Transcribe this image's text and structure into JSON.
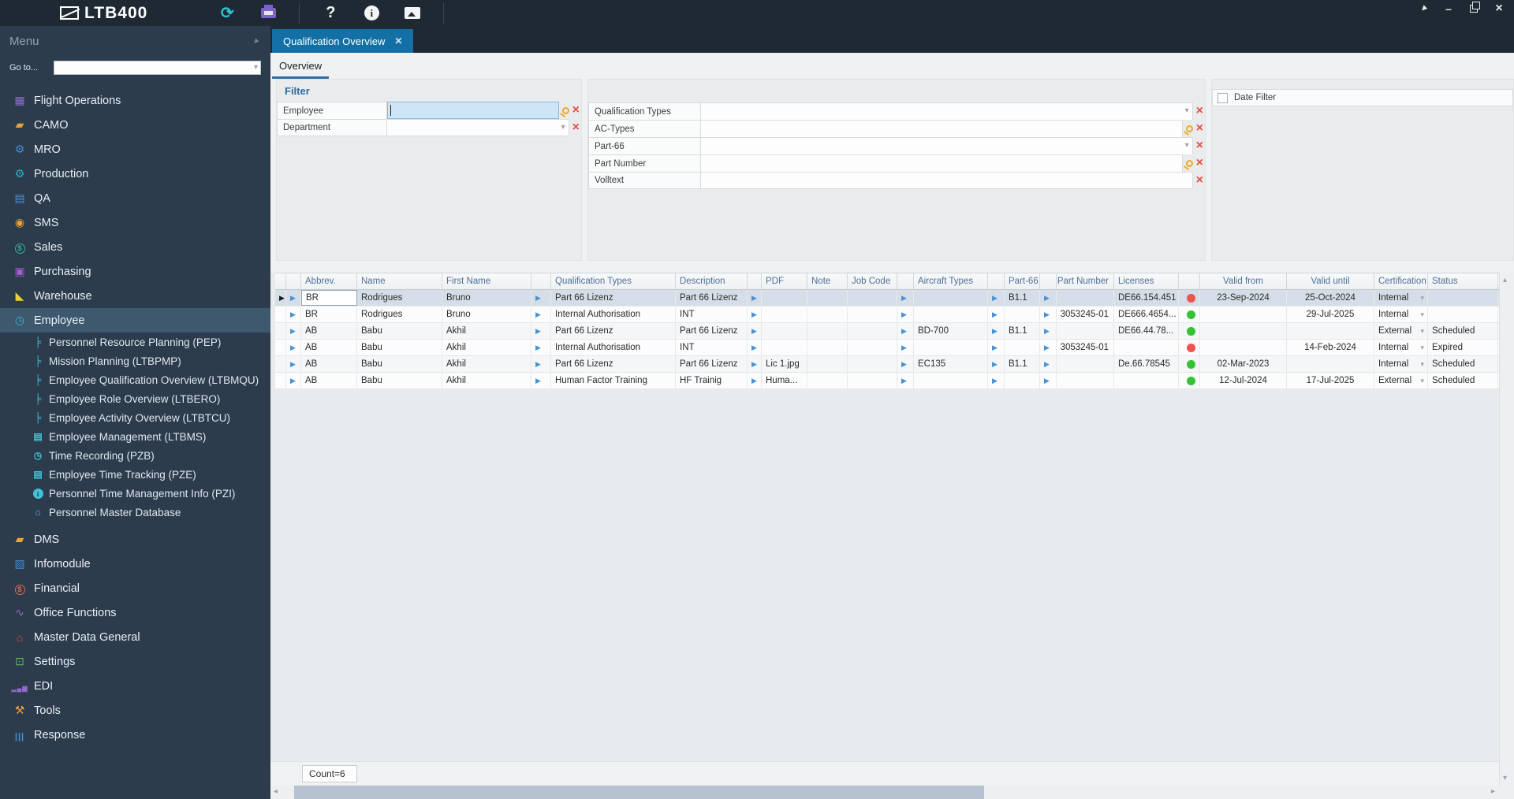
{
  "window": {
    "logo_text": "LTB400",
    "titlebar_icons": [
      "refresh-icon",
      "printer-icon",
      "help-icon",
      "info-icon",
      "image-icon"
    ],
    "window_controls": [
      "pin-icon",
      "minimize-icon",
      "maximize-icon",
      "close-icon"
    ]
  },
  "sidebar": {
    "menu_title": "Menu",
    "goto_label": "Go to...",
    "goto_value": "",
    "items": [
      {
        "label": "Flight Operations",
        "icon": "calendar-icon",
        "color": "#8f6cd0"
      },
      {
        "label": "CAMO",
        "icon": "tag-icon",
        "color": "#e3a23c"
      },
      {
        "label": "MRO",
        "icon": "gear-icon",
        "color": "#3f8ed8"
      },
      {
        "label": "Production",
        "icon": "gears-icon",
        "color": "#2ab5c3"
      },
      {
        "label": "QA",
        "icon": "folder-docs-icon",
        "color": "#4b90d8"
      },
      {
        "label": "SMS",
        "icon": "bell-icon",
        "color": "#f0a231"
      },
      {
        "label": "Sales",
        "icon": "dollar-circle-icon",
        "color": "#2fae9b"
      },
      {
        "label": "Purchasing",
        "icon": "cart-icon",
        "color": "#a45fd0"
      },
      {
        "label": "Warehouse",
        "icon": "handtruck-icon",
        "color": "#e8cf3a"
      },
      {
        "label": "Employee",
        "icon": "clock-circle-icon",
        "color": "#35bdd3",
        "selected": true,
        "children": [
          {
            "label": "Personnel Resource Planning (PEP)",
            "icon": "org-chart-icon"
          },
          {
            "label": "Mission Planning (LTBPMP)",
            "icon": "org-chart-icon"
          },
          {
            "label": "Employee Qualification Overview (LTBMQU)",
            "icon": "org-chart-icon"
          },
          {
            "label": "Employee Role Overview (LTBERO)",
            "icon": "org-chart-icon"
          },
          {
            "label": "Employee Activity Overview (LTBTCU)",
            "icon": "org-chart-icon"
          },
          {
            "label": "Employee Management (LTBMS)",
            "icon": "document-icon"
          },
          {
            "label": "Time Recording (PZB)",
            "icon": "clock-circle-icon"
          },
          {
            "label": "Employee Time Tracking (PZE)",
            "icon": "document-icon"
          },
          {
            "label": "Personnel Time Management Info (PZI)",
            "icon": "info-icon"
          },
          {
            "label": "Personnel Master Database",
            "icon": "home-icon"
          }
        ]
      },
      {
        "label": "DMS",
        "icon": "folder-icon",
        "color": "#eda735"
      },
      {
        "label": "Infomodule",
        "icon": "chart-icon",
        "color": "#3f8ed8"
      },
      {
        "label": "Financial",
        "icon": "money-icon",
        "color": "#e2694a"
      },
      {
        "label": "Office Functions",
        "icon": "paperclip-icon",
        "color": "#9068cc"
      },
      {
        "label": "Master Data General",
        "icon": "home-icon",
        "color": "#dd4f44"
      },
      {
        "label": "Settings",
        "icon": "monitor-icon",
        "color": "#5cb85c"
      },
      {
        "label": "EDI",
        "icon": "barchart-icon",
        "color": "#9068cc"
      },
      {
        "label": "Tools",
        "icon": "tools-icon",
        "color": "#eda32f"
      },
      {
        "label": "Response",
        "icon": "barcode-icon",
        "color": "#4b90d8"
      }
    ]
  },
  "tabs": {
    "document_tab": "Qualification Overview",
    "sub_tab": "Overview"
  },
  "filters": {
    "title": "Filter",
    "left": [
      {
        "label": "Employee",
        "type": "search",
        "value": "",
        "focused": true
      },
      {
        "label": "Department",
        "type": "dropdown",
        "value": ""
      }
    ],
    "middle": [
      {
        "label": "Qualification Types",
        "type": "dropdown",
        "value": ""
      },
      {
        "label": "AC-Types",
        "type": "search",
        "value": ""
      },
      {
        "label": "Part-66",
        "type": "dropdown",
        "value": ""
      },
      {
        "label": "Part Number",
        "type": "search",
        "value": ""
      },
      {
        "label": "Volltext",
        "type": "text",
        "value": ""
      }
    ],
    "date_filter": {
      "label": "Date Filter",
      "checked": false
    }
  },
  "table": {
    "columns": [
      "Abbrev.",
      "Name",
      "First Name",
      "Qualification Types",
      "Description",
      "PDF",
      "Note",
      "Job Code",
      "Aircraft Types",
      "Part-66",
      "Part Number",
      "Licenses",
      "Valid from",
      "Valid until",
      "Certification",
      "Status"
    ],
    "rows": [
      {
        "abbrev": "BR",
        "name": "Rodrigues",
        "first_name": "Bruno",
        "qualification_types": "Part 66 Lizenz",
        "description": "Part 66 Lizenz",
        "pdf": "",
        "note": "",
        "job_code": "",
        "aircraft_types": "",
        "part_66": "B1.1",
        "part_number": "",
        "licenses": "DE66.154.451",
        "indicator": "red",
        "valid_from": "23-Sep-2024",
        "valid_until": "25-Oct-2024",
        "certification": "Internal",
        "status": "",
        "selected": true
      },
      {
        "abbrev": "BR",
        "name": "Rodrigues",
        "first_name": "Bruno",
        "qualification_types": "Internal Authorisation",
        "description": "INT",
        "pdf": "",
        "note": "",
        "job_code": "",
        "aircraft_types": "",
        "part_66": "",
        "part_number": "3053245-01",
        "licenses": "DE666.4654...",
        "indicator": "green",
        "valid_from": "",
        "valid_until": "29-Jul-2025",
        "certification": "Internal",
        "status": ""
      },
      {
        "abbrev": "AB",
        "name": "Babu",
        "first_name": "Akhil",
        "qualification_types": "Part 66 Lizenz",
        "description": "Part 66 Lizenz",
        "pdf": "",
        "note": "",
        "job_code": "",
        "aircraft_types": "BD-700",
        "part_66": "B1.1",
        "part_number": "",
        "licenses": "DE66.44.78...",
        "indicator": "green",
        "valid_from": "",
        "valid_until": "",
        "certification": "External",
        "status": "Scheduled"
      },
      {
        "abbrev": "AB",
        "name": "Babu",
        "first_name": "Akhil",
        "qualification_types": "Internal Authorisation",
        "description": "INT",
        "pdf": "",
        "note": "",
        "job_code": "",
        "aircraft_types": "",
        "part_66": "",
        "part_number": "3053245-01",
        "licenses": "",
        "indicator": "red",
        "valid_from": "",
        "valid_until": "14-Feb-2024",
        "certification": "Internal",
        "status": "Expired"
      },
      {
        "abbrev": "AB",
        "name": "Babu",
        "first_name": "Akhil",
        "qualification_types": "Part 66 Lizenz",
        "description": "Part 66 Lizenz",
        "pdf": "Lic 1.jpg",
        "note": "",
        "job_code": "",
        "aircraft_types": "EC135",
        "part_66": "B1.1",
        "part_number": "",
        "licenses": "De.66.78545",
        "indicator": "green",
        "valid_from": "02-Mar-2023",
        "valid_until": "",
        "certification": "Internal",
        "status": "Scheduled"
      },
      {
        "abbrev": "AB",
        "name": "Babu",
        "first_name": "Akhil",
        "qualification_types": "Human Factor Training",
        "description": "HF Trainig",
        "pdf": "Huma...",
        "note": "",
        "job_code": "",
        "aircraft_types": "",
        "part_66": "",
        "part_number": "",
        "licenses": "",
        "indicator": "green",
        "valid_from": "12-Jul-2024",
        "valid_until": "17-Jul-2025",
        "certification": "External",
        "status": "Scheduled"
      }
    ],
    "count_label": "Count=6",
    "status_colors": {
      "red": "#ef5350",
      "green": "#35c135"
    }
  },
  "colors": {
    "accent_blue": "#1470a4",
    "filter_accent": "#2e6da4",
    "clear_red": "#e25045",
    "search_orange": "#eda929",
    "row_selected": "#d5dee8"
  }
}
